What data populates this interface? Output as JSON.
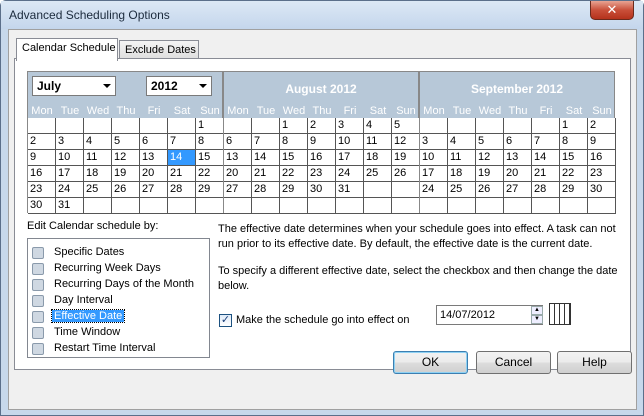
{
  "window": {
    "title": "Advanced Scheduling Options",
    "close": "✕"
  },
  "tabs": [
    {
      "label": "Calendar Schedule"
    },
    {
      "label": "Exclude Dates"
    }
  ],
  "calendar": {
    "month_select": "July",
    "year_select": "2012",
    "day_headers": [
      "Mon",
      "Tue",
      "Wed",
      "Thu",
      "Fri",
      "Sat",
      "Sun"
    ],
    "months": [
      {
        "title": "",
        "weeks": [
          [
            "",
            "",
            "",
            "",
            "",
            "",
            "1"
          ],
          [
            "2",
            "3",
            "4",
            "5",
            "6",
            "7",
            "8"
          ],
          [
            "9",
            "10",
            "11",
            "12",
            "13",
            "14",
            "15"
          ],
          [
            "16",
            "17",
            "18",
            "19",
            "20",
            "21",
            "22"
          ],
          [
            "23",
            "24",
            "25",
            "26",
            "27",
            "28",
            "29"
          ],
          [
            "30",
            "31",
            "",
            "",
            "",
            "",
            ""
          ]
        ]
      },
      {
        "title": "August 2012",
        "weeks": [
          [
            "",
            "",
            "1",
            "2",
            "3",
            "4",
            "5"
          ],
          [
            "6",
            "7",
            "8",
            "9",
            "10",
            "11",
            "12"
          ],
          [
            "13",
            "14",
            "15",
            "16",
            "17",
            "18",
            "19"
          ],
          [
            "20",
            "21",
            "22",
            "23",
            "24",
            "25",
            "26"
          ],
          [
            "27",
            "28",
            "29",
            "30",
            "31",
            "",
            ""
          ],
          [
            "",
            "",
            "",
            "",
            "",
            "",
            ""
          ]
        ]
      },
      {
        "title": "September 2012",
        "weeks": [
          [
            "",
            "",
            "",
            "",
            "",
            "1",
            "2"
          ],
          [
            "3",
            "4",
            "5",
            "6",
            "7",
            "8",
            "9"
          ],
          [
            "10",
            "11",
            "12",
            "13",
            "14",
            "15",
            "16"
          ],
          [
            "17",
            "18",
            "19",
            "20",
            "21",
            "22",
            "23"
          ],
          [
            "24",
            "25",
            "26",
            "27",
            "28",
            "29",
            "30"
          ],
          [
            "",
            "",
            "",
            "",
            "",
            "",
            ""
          ]
        ]
      }
    ],
    "selected_day": "14"
  },
  "schedule": {
    "heading": "Edit Calendar schedule by:",
    "items": [
      {
        "label": "Specific Dates",
        "icon": "calendar-dates-icon"
      },
      {
        "label": "Recurring Week Days",
        "icon": "week-days-icon"
      },
      {
        "label": "Recurring Days of the Month",
        "icon": "month-days-icon"
      },
      {
        "label": "Day Interval",
        "icon": "day-interval-icon"
      },
      {
        "label": "Effective Date",
        "icon": "effective-date-icon"
      },
      {
        "label": "Time Window",
        "icon": "time-window-icon"
      },
      {
        "label": "Restart Time Interval",
        "icon": "restart-interval-icon"
      }
    ],
    "active_index": 4
  },
  "description": {
    "line1": "The effective date determines when your schedule goes into effect. A task can not run prior to its effective date. By default, the effective date is the current date.",
    "line2": "To specify a different effective date, select the checkbox and then change the date below."
  },
  "effective": {
    "checkbox_label": "Make the schedule go into effect on",
    "checked": true,
    "date_value": "14/07/2012"
  },
  "buttons": {
    "ok": "OK",
    "cancel": "Cancel",
    "help": "Help"
  }
}
